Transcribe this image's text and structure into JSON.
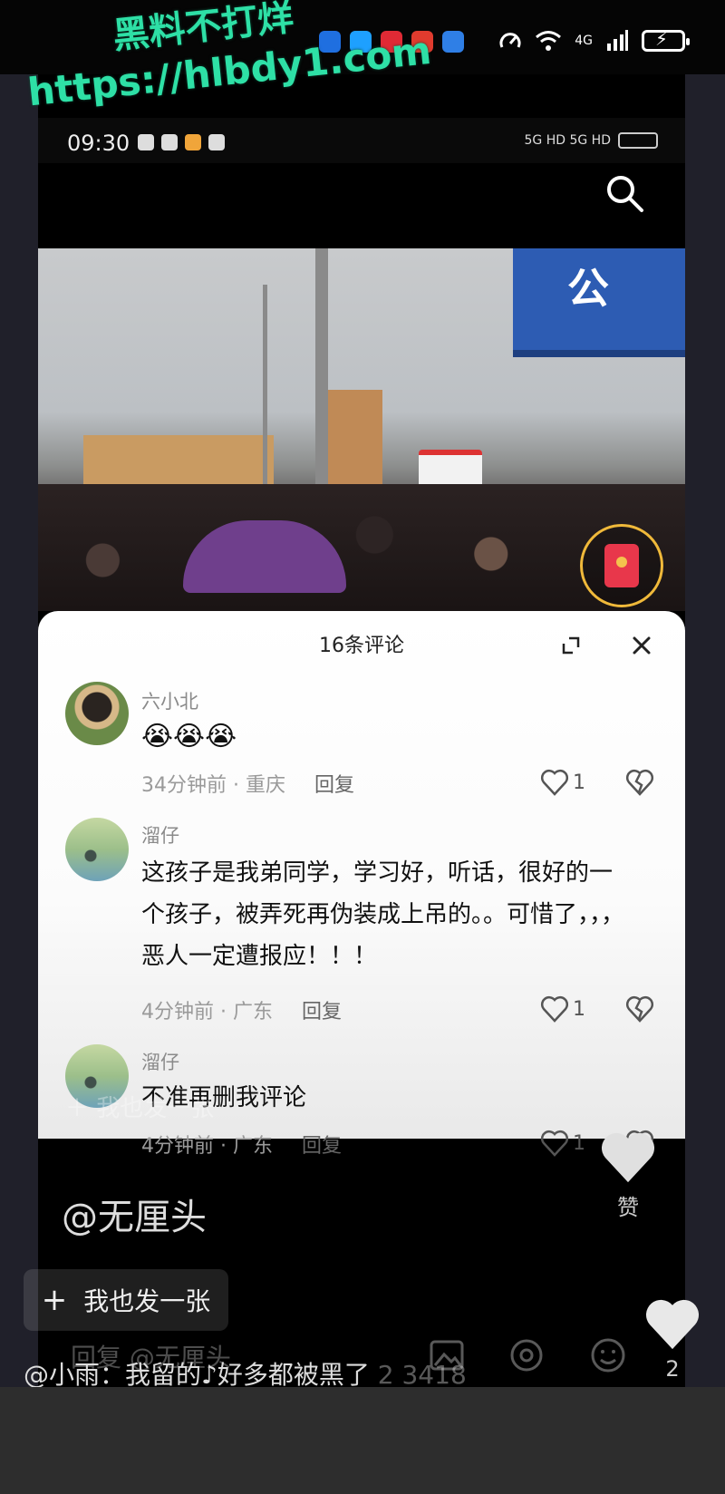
{
  "outer_status": {
    "time": "",
    "network": "4G",
    "app_icon_colors": [
      "#1f6fe0",
      "#1ea0ff",
      "#e02a35",
      "#e03b2e",
      "#2f7fe6"
    ]
  },
  "watermark": {
    "line1": "黑料不打烊",
    "line2": "https://hlbdy1.com"
  },
  "inner_status": {
    "time": "09:30",
    "network": "5G HD 5G HD"
  },
  "comment_sheet": {
    "title": "16条评论",
    "comments": [
      {
        "username": "六小北",
        "text": "😭😭😭",
        "time": "34分钟前 · 重庆",
        "reply": "回复",
        "likes": "1"
      },
      {
        "username": "溜仔",
        "text": "这孩子是我弟同学，学习好，听话，很好的一个孩子，被弄死再伪装成上吊的。。可惜了，，，恶人一定遭报应！！！",
        "time": "4分钟前 · 广东",
        "reply": "回复",
        "likes": "1"
      },
      {
        "username": "溜仔",
        "text": "不准再删我评论",
        "time": "4分钟前 · 广东",
        "reply": "回复",
        "likes": "1"
      }
    ]
  },
  "overlay": {
    "ghost_post": "＋ 我也发一张",
    "handle": "@无厘头",
    "like_label": "赞",
    "post_button": "我也发一张",
    "reply_ghost": "回复 @无厘头",
    "footer_text": "@小雨：我留的♪好多都被黑了",
    "footer_count": "2 3418",
    "heart_count": "2"
  },
  "colors": {
    "watermark": "#2ee0a6",
    "red_packet": "#e8374b",
    "red_packet_ring": "#f0b93a"
  }
}
